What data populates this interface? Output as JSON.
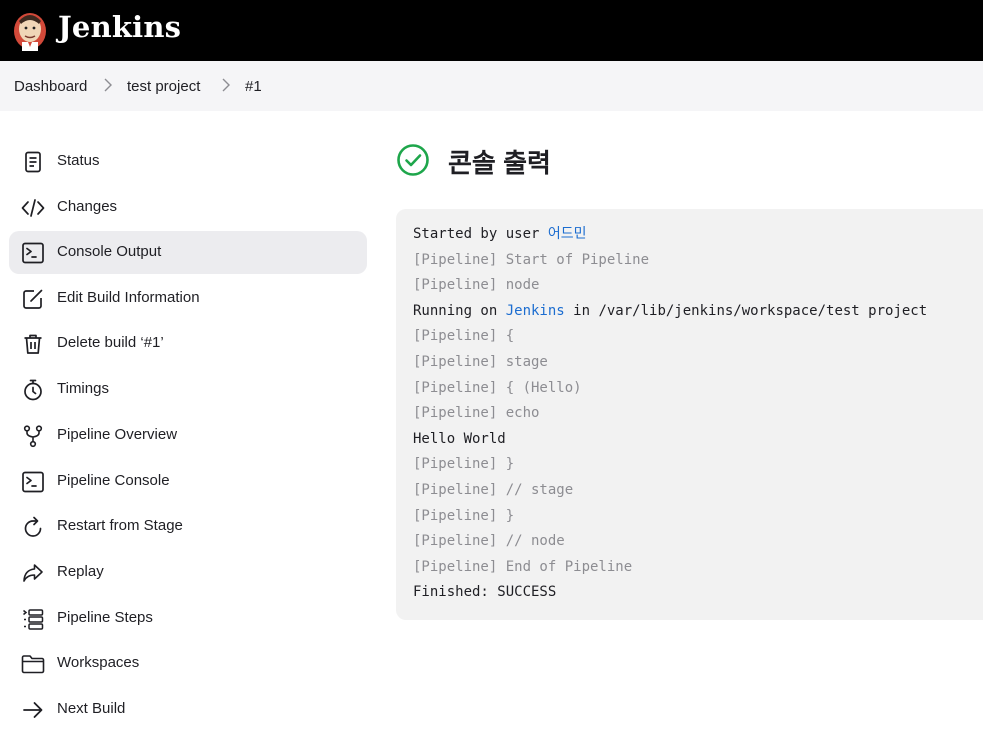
{
  "header": {
    "brand": "Jenkins"
  },
  "breadcrumb": [
    {
      "label": "Dashboard"
    },
    {
      "label": "test project"
    },
    {
      "label": "#1"
    }
  ],
  "sidebar": {
    "items": [
      {
        "label": "Status",
        "icon": "document-icon"
      },
      {
        "label": "Changes",
        "icon": "code-icon"
      },
      {
        "label": "Console Output",
        "icon": "terminal-icon",
        "active": true
      },
      {
        "label": "Edit Build Information",
        "icon": "edit-icon"
      },
      {
        "label": "Delete build ‘#1’",
        "icon": "trash-icon"
      },
      {
        "label": "Timings",
        "icon": "stopwatch-icon"
      },
      {
        "label": "Pipeline Overview",
        "icon": "branch-icon"
      },
      {
        "label": "Pipeline Console",
        "icon": "terminal-icon"
      },
      {
        "label": "Restart from Stage",
        "icon": "restart-icon"
      },
      {
        "label": "Replay",
        "icon": "replay-icon"
      },
      {
        "label": "Pipeline Steps",
        "icon": "steps-icon"
      },
      {
        "label": "Workspaces",
        "icon": "folder-icon"
      },
      {
        "label": "Next Build",
        "icon": "arrow-right-icon"
      }
    ]
  },
  "main": {
    "title": "콘솔 출력",
    "status_icon": "success-check-icon",
    "status_color": "#1ea64b",
    "console": {
      "started_prefix": "Started by user ",
      "started_user": "어드민",
      "line_start_pipeline": "[Pipeline] Start of Pipeline",
      "line_node": "[Pipeline] node",
      "running_prefix": "Running on ",
      "running_node": "Jenkins",
      "running_suffix": " in /var/lib/jenkins/workspace/test project",
      "line_open_brace": "[Pipeline] {",
      "line_stage": "[Pipeline] stage",
      "line_open_hello": "[Pipeline] { (Hello)",
      "line_echo": "[Pipeline] echo",
      "line_hello_world": "Hello World",
      "line_close_1": "[Pipeline] }",
      "line_stage_end": "[Pipeline] // stage",
      "line_close_2": "[Pipeline] }",
      "line_node_end": "[Pipeline] // node",
      "line_end_pipeline": "[Pipeline] End of Pipeline",
      "line_finished": "Finished: SUCCESS"
    }
  },
  "colors": {
    "link": "#1c6dd0",
    "dim_text": "#8d8d92",
    "active_bg": "#ececef"
  }
}
